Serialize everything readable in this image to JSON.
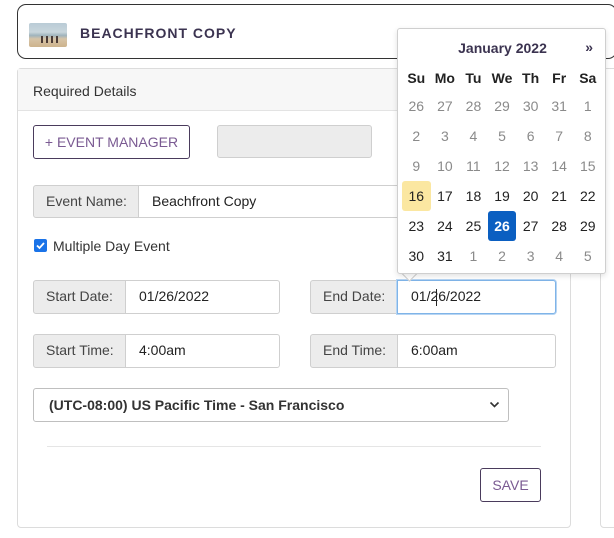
{
  "header": {
    "title": "BEACHFRONT COPY"
  },
  "card": {
    "title": "Required Details"
  },
  "event_manager_button": "+ EVENT MANAGER",
  "event_name": {
    "label": "Event Name:",
    "value": "Beachfront Copy"
  },
  "multiple_day": {
    "label": "Multiple Day Event",
    "checked": true
  },
  "start_date": {
    "label": "Start Date:",
    "value": "01/26/2022"
  },
  "end_date": {
    "label": "End Date:",
    "value": "01/26/2022"
  },
  "start_time": {
    "label": "Start Time:",
    "value": "4:00am"
  },
  "end_time": {
    "label": "End Time:",
    "value": "6:00am"
  },
  "timezone": {
    "selected": "(UTC-08:00) US Pacific Time - San Francisco"
  },
  "save_button": "SAVE",
  "calendar": {
    "month_label": "January 2022",
    "next_label": "»",
    "weekdays": [
      "Su",
      "Mo",
      "Tu",
      "We",
      "Th",
      "Fr",
      "Sa"
    ],
    "today": "16",
    "selected": "26",
    "weeks": [
      [
        "26",
        "27",
        "28",
        "29",
        "30",
        "31",
        "1"
      ],
      [
        "2",
        "3",
        "4",
        "5",
        "6",
        "7",
        "8"
      ],
      [
        "9",
        "10",
        "11",
        "12",
        "13",
        "14",
        "15"
      ],
      [
        "16",
        "17",
        "18",
        "19",
        "20",
        "21",
        "22"
      ],
      [
        "23",
        "24",
        "25",
        "26",
        "27",
        "28",
        "29"
      ],
      [
        "30",
        "31",
        "1",
        "2",
        "3",
        "4",
        "5"
      ]
    ],
    "muted": [
      [
        true,
        true,
        true,
        true,
        true,
        true,
        true
      ],
      [
        true,
        true,
        true,
        true,
        true,
        true,
        true
      ],
      [
        true,
        true,
        true,
        true,
        true,
        true,
        true
      ],
      [
        false,
        false,
        false,
        false,
        false,
        false,
        false
      ],
      [
        false,
        false,
        false,
        false,
        false,
        false,
        false
      ],
      [
        false,
        false,
        true,
        true,
        true,
        true,
        true
      ]
    ]
  },
  "colors": {
    "accent": "#7a5a92",
    "selected_day": "#0b5fc1",
    "today_day": "#fbe7a1",
    "checkbox": "#1a73e8"
  }
}
